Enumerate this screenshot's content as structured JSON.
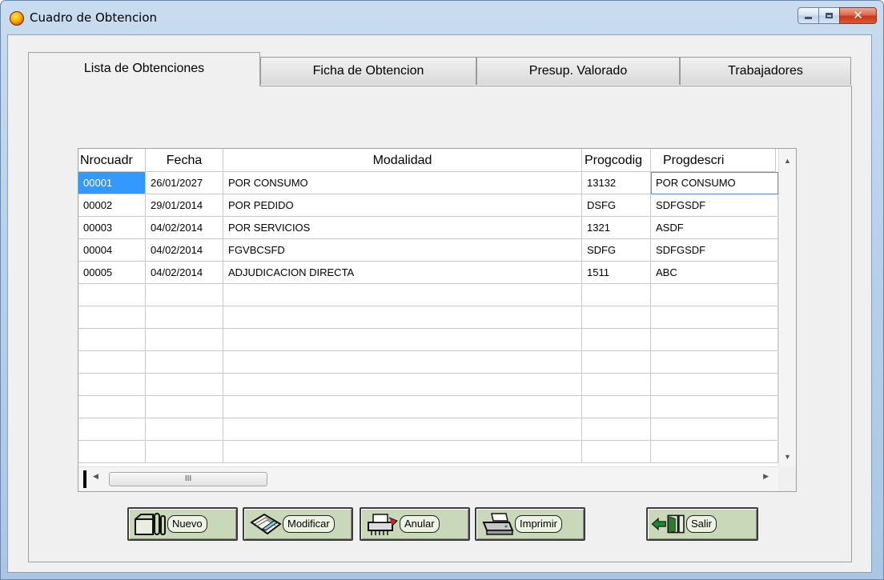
{
  "window": {
    "title": "Cuadro de Obtencion",
    "controls": {
      "minimize_icon": "minimize-icon",
      "maximize_icon": "maximize-icon",
      "close_icon": "close-icon"
    }
  },
  "tabs": [
    {
      "label": "Lista de Obtenciones",
      "active": true
    },
    {
      "label": "Ficha de Obtencion",
      "active": false
    },
    {
      "label": "Presup. Valorado",
      "active": false
    },
    {
      "label": "Trabajadores",
      "active": false
    }
  ],
  "grid": {
    "columns": [
      "Nrocuadr",
      "Fecha",
      "Modalidad",
      "Progcodig",
      "Progdescri"
    ],
    "rows": [
      [
        "00001",
        "26/01/2027",
        "POR CONSUMO",
        "13132",
        "POR CONSUMO"
      ],
      [
        "00002",
        "29/01/2014",
        "POR PEDIDO",
        "DSFG",
        "SDFGSDF"
      ],
      [
        "00003",
        "04/02/2014",
        "POR SERVICIOS",
        "1321",
        "ASDF"
      ],
      [
        "00004",
        "04/02/2014",
        "FGVBCSFD",
        "SDFG",
        "SDFGSDF"
      ],
      [
        "00005",
        "04/02/2014",
        "ADJUDICACION DIRECTA",
        "1511",
        "ABC"
      ]
    ],
    "empty_rows": 8,
    "selected_row": 0,
    "hscroll_thumb_text": "III"
  },
  "buttons": {
    "nuevo": "Nuevo",
    "modificar": "Modificar",
    "anular": "Anular",
    "imprimir": "Imprimir",
    "salir": "Salir"
  },
  "colors": {
    "selection": "#3399ff",
    "button_face": "#c9d8b8",
    "close_button": "#c7391c"
  }
}
